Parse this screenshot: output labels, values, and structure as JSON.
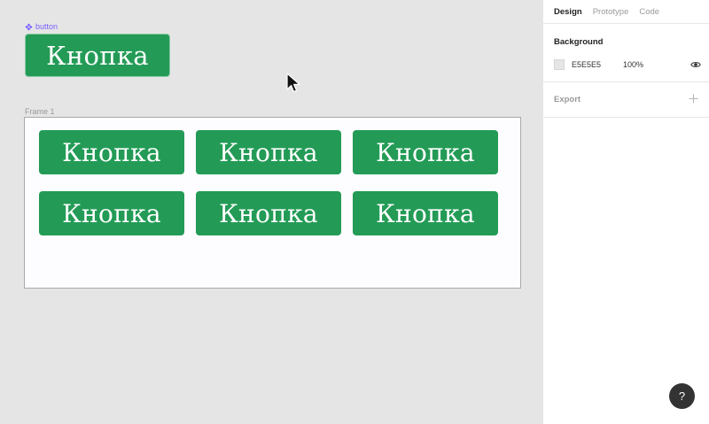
{
  "canvas": {
    "component": {
      "label": "button",
      "icon": "component-icon",
      "button_label": "Кнопка"
    },
    "frame": {
      "label": "Frame 1",
      "buttons": [
        "Кнопка",
        "Кнопка",
        "Кнопка",
        "Кнопка",
        "Кнопка",
        "Кнопка"
      ]
    },
    "cursor_icon": "arrow-cursor-icon"
  },
  "panel": {
    "tabs": [
      "Design",
      "Prototype",
      "Code"
    ],
    "active_tab": "Design",
    "background": {
      "title": "Background",
      "hex": "E5E5E5",
      "opacity": "100%",
      "visibility_icon": "eye-icon"
    },
    "export": {
      "title": "Export",
      "add_icon": "plus-icon"
    }
  },
  "help": {
    "label": "?"
  },
  "colors": {
    "button_green": "#239b56",
    "canvas_bg": "#e5e5e5",
    "component_purple": "#7b61ff"
  }
}
